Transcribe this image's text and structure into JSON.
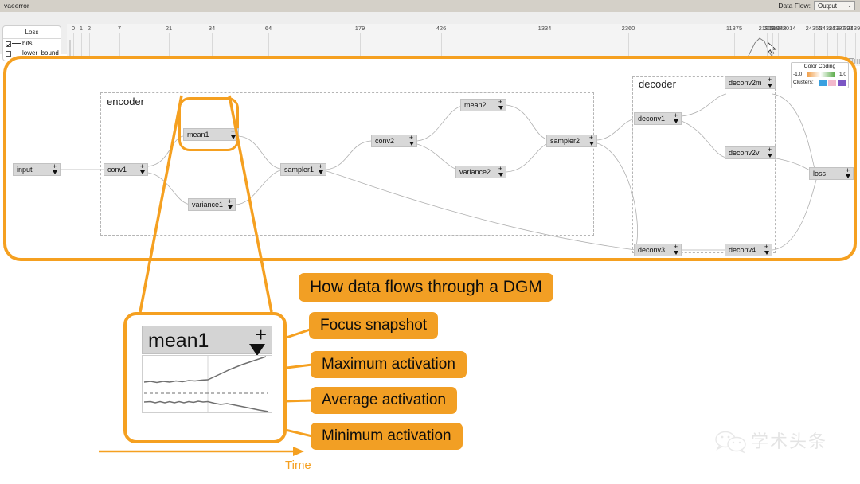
{
  "titlebar": {
    "title": "vaeerror"
  },
  "toolbar": {
    "data_flow_label": "Data Flow:",
    "data_flow_value": "Output"
  },
  "timeline": {
    "legend": {
      "title": "Loss",
      "items": [
        {
          "label": "bits",
          "checked": true,
          "style": "solid"
        },
        {
          "label": "lower_bound",
          "checked": false,
          "style": "dashed"
        }
      ]
    },
    "ticks": [
      "0",
      "1",
      "2",
      "7",
      "21",
      "34",
      "64",
      "179",
      "426",
      "1334",
      "2360",
      "11375",
      "21919",
      "21945",
      "21948",
      "22014",
      "24355",
      "24382",
      "24387",
      "24391",
      "24396"
    ],
    "marker": "×"
  },
  "color_coding": {
    "title": "Color Coding",
    "min": "-1.0",
    "max": "1.0",
    "clusters_label": "Clusters:",
    "gradient_low": "#f0993f",
    "gradient_mid": "#ffffff",
    "gradient_high": "#5fae4e",
    "cluster_colors": [
      "#3aa0e0",
      "#f2b9cc",
      "#7b56c4"
    ]
  },
  "graph": {
    "groups": [
      {
        "label": "encoder"
      },
      {
        "label": "decoder"
      }
    ],
    "nodes": [
      {
        "id": "input",
        "label": "input"
      },
      {
        "id": "conv1",
        "label": "conv1"
      },
      {
        "id": "mean1",
        "label": "mean1"
      },
      {
        "id": "variance1",
        "label": "variance1"
      },
      {
        "id": "sampler1",
        "label": "sampler1"
      },
      {
        "id": "conv2",
        "label": "conv2"
      },
      {
        "id": "mean2",
        "label": "mean2"
      },
      {
        "id": "variance2",
        "label": "variance2"
      },
      {
        "id": "sampler2",
        "label": "sampler2"
      },
      {
        "id": "deconv1",
        "label": "deconv1"
      },
      {
        "id": "deconv2m",
        "label": "deconv2m"
      },
      {
        "id": "deconv2v",
        "label": "deconv2v"
      },
      {
        "id": "deconv3",
        "label": "deconv3"
      },
      {
        "id": "deconv4",
        "label": "deconv4"
      },
      {
        "id": "loss",
        "label": "loss"
      }
    ],
    "node_plus": "+"
  },
  "annotations": {
    "title": "How data flows through a DGM",
    "focus_snapshot": "Focus snapshot",
    "maximum_activation": "Maximum activation",
    "average_activation": "Average activation",
    "minimum_activation": "Minimum activation",
    "time_axis": "Time"
  },
  "detail": {
    "node_label": "mean1",
    "plus": "+"
  },
  "watermark": {
    "text": "学术头条"
  },
  "colors": {
    "accent": "#F5A020",
    "callout": "#F29F24",
    "node_fill": "#d8d8d8"
  }
}
